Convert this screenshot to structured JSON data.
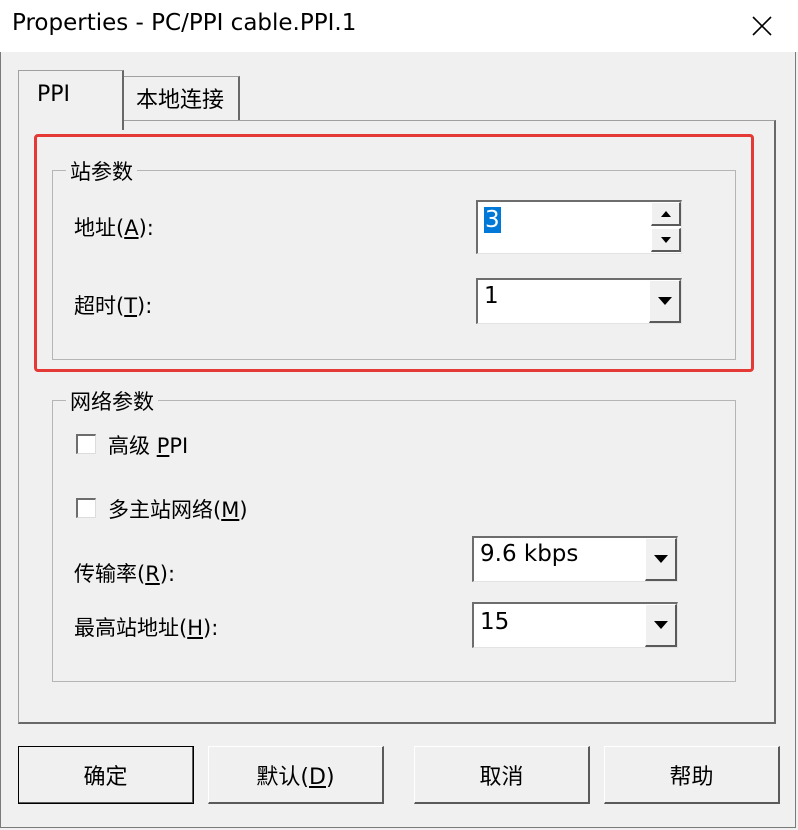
{
  "window": {
    "title": "Properties - PC/PPI cable.PPI.1"
  },
  "tabs": [
    {
      "label": "PPI",
      "active": true
    },
    {
      "label": "本地连接",
      "active": false
    }
  ],
  "station_params": {
    "legend": "站参数",
    "address": {
      "label_pre": "地址(",
      "label_key": "A",
      "label_post": "):",
      "value": "3"
    },
    "timeout": {
      "label_pre": "超时(",
      "label_key": "T",
      "label_post": "):",
      "value": "1"
    }
  },
  "network_params": {
    "legend": "网络参数",
    "advanced_ppi": {
      "label_pre": "高级 ",
      "label_key": "P",
      "label_post": "PI",
      "checked": false
    },
    "multi_master": {
      "label_pre": "多主站网络(",
      "label_key": "M",
      "label_post": ")",
      "checked": false
    },
    "baud_rate": {
      "label_pre": "传输率(",
      "label_key": "R",
      "label_post": "):",
      "value": "9.6 kbps"
    },
    "highest_address": {
      "label_pre": "最高站地址(",
      "label_key": "H",
      "label_post": "):",
      "value": "15"
    }
  },
  "buttons": {
    "ok": "确定",
    "default": {
      "pre": "默认(",
      "key": "D",
      "post": ")"
    },
    "cancel": "取消",
    "help": "帮助"
  },
  "colors": {
    "annotation_box": "#e53935",
    "selection": "#0078d7"
  }
}
